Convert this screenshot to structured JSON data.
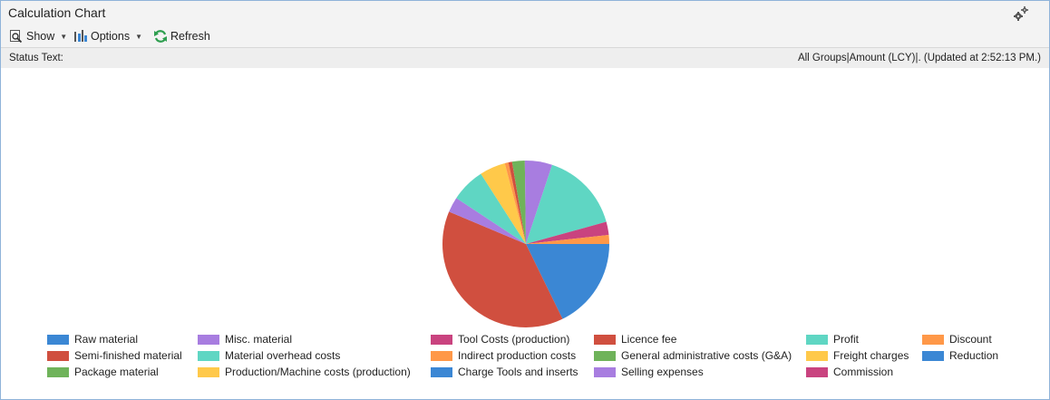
{
  "window": {
    "title": "Calculation Chart"
  },
  "toolbar": {
    "show_label": "Show",
    "options_label": "Options",
    "refresh_label": "Refresh"
  },
  "status": {
    "label": "Status Text:",
    "value": "All Groups|Amount (LCY)|. (Updated at  2:52:13 PM.)"
  },
  "icons": {
    "gear": "settings-gears-icon",
    "show": "magnifier-page-icon",
    "options": "options-sliders-icon",
    "refresh": "refresh-arrows-icon"
  },
  "chart_data": {
    "type": "pie",
    "legend_placement": "bottom",
    "series": [
      {
        "name": "Raw material",
        "color": "#3b87d4",
        "value": 17.4
      },
      {
        "name": "Semi-finished material",
        "color": "#d04f3f",
        "value": 37.8
      },
      {
        "name": "Package material",
        "color": "#6fb35a",
        "value": 0.0
      },
      {
        "name": "Misc. material",
        "color": "#a87de0",
        "value": 2.9
      },
      {
        "name": "Material overhead costs",
        "color": "#5fd6c3",
        "value": 6.5
      },
      {
        "name": "Production/Machine costs (production)",
        "color": "#ffc94a",
        "value": 4.9
      },
      {
        "name": "Tool Costs (production)",
        "color": "#c9437f",
        "value": 0.0
      },
      {
        "name": "Indirect production costs",
        "color": "#ff9848",
        "value": 0.7
      },
      {
        "name": "Charge Tools and inserts",
        "color": "#3b87d4",
        "value": 0.0
      },
      {
        "name": "Licence fee",
        "color": "#d04f3f",
        "value": 0.7
      },
      {
        "name": "General administrative costs (G&A)",
        "color": "#6fb35a",
        "value": 2.4
      },
      {
        "name": "Selling expenses",
        "color": "#a87de0",
        "value": 5.2
      },
      {
        "name": "Profit",
        "color": "#5fd6c3",
        "value": 15.3
      },
      {
        "name": "Freight charges",
        "color": "#ffc94a",
        "value": 0.0
      },
      {
        "name": "Commission",
        "color": "#c9437f",
        "value": 2.5
      },
      {
        "name": "Discount",
        "color": "#ff9848",
        "value": 1.7
      },
      {
        "name": "Reduction",
        "color": "#3b87d4",
        "value": 0.0
      }
    ]
  }
}
